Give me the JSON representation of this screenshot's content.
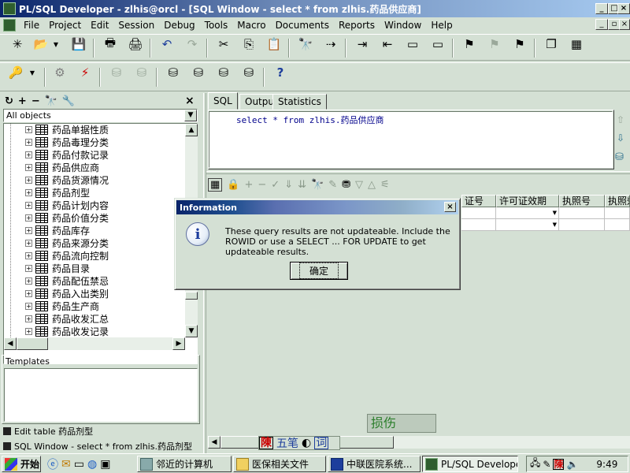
{
  "window": {
    "title": "PL/SQL Developer - zlhis@orcl - [SQL Window - select * from zlhis.药品供应商]"
  },
  "menu": [
    "File",
    "Project",
    "Edit",
    "Session",
    "Debug",
    "Tools",
    "Macro",
    "Documents",
    "Reports",
    "Window",
    "Help"
  ],
  "object_browser": {
    "filter": "All objects",
    "items": [
      "药品单据性质",
      "药品毒理分类",
      "药品付款记录",
      "药品供应商",
      "药品货源情况",
      "药品剂型",
      "药品计划内容",
      "药品价值分类",
      "药品库存",
      "药品来源分类",
      "药品流向控制",
      "药品目录",
      "药品配伍禁忌",
      "药品入出类别",
      "药品生产商",
      "药品收发汇总",
      "药品收发记录"
    ]
  },
  "templates": {
    "label": "Templates"
  },
  "window_list": [
    "Edit table 药品剂型",
    "SQL Window - select * from zlhis.药品剂型"
  ],
  "sql_window": {
    "tabs": [
      "SQL",
      "Output",
      "Statistics"
    ],
    "query": "select * from zlhis.药品供应商"
  },
  "result_grid": {
    "columns": [
      "证号",
      "许可证效期",
      "执照号",
      "执照效"
    ]
  },
  "dialog": {
    "title": "Information",
    "message": "These query results are not updateable. Include the ROWID or use a SELECT ... FOR UPDATE to get updateable results.",
    "ok_label": "确定",
    "close_label": "×"
  },
  "ime_bar": {
    "mode": "五笔",
    "word": "词",
    "float_text": "损伤"
  },
  "taskbar": {
    "start_label": "开始",
    "buttons": [
      "邻近的计算机",
      "医保相关文件",
      "中联医院系统...",
      "PL/SQL Develope..."
    ],
    "clock": "9:49"
  },
  "colors": {
    "face": "#d4e0d4",
    "title_active": "#0a246a",
    "title_end": "#a6caf0"
  }
}
